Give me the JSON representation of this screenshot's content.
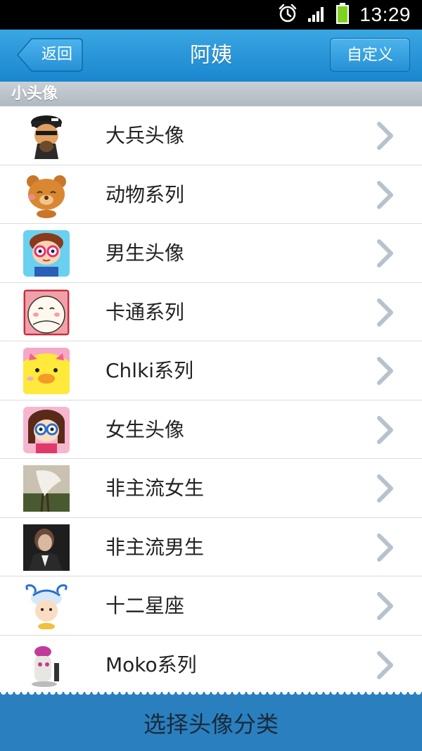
{
  "status_bar": {
    "time": "13:29",
    "icons": [
      "alarm-icon",
      "signal-icon",
      "battery-icon"
    ]
  },
  "nav": {
    "back_label": "返回",
    "title": "阿姨",
    "custom_label": "自定义"
  },
  "section": {
    "header": "小头像"
  },
  "list": {
    "items": [
      {
        "label": "大兵头像",
        "icon": "soldier-avatar"
      },
      {
        "label": "动物系列",
        "icon": "bear-avatar"
      },
      {
        "label": "男生头像",
        "icon": "boy-avatar"
      },
      {
        "label": "卡通系列",
        "icon": "cartoon-avatar"
      },
      {
        "label": "Chlki系列",
        "icon": "chick-avatar"
      },
      {
        "label": "女生头像",
        "icon": "girl-avatar"
      },
      {
        "label": "非主流女生",
        "icon": "photo-woman-avatar"
      },
      {
        "label": "非主流男生",
        "icon": "photo-man-avatar"
      },
      {
        "label": "十二星座",
        "icon": "zodiac-avatar"
      },
      {
        "label": "Moko系列",
        "icon": "moko-avatar"
      }
    ]
  },
  "bottom": {
    "label": "选择头像分类"
  },
  "colors": {
    "nav_blue": "#1f8cd3",
    "bottom_blue": "#2a7fbf",
    "section_gray": "#b9c1c8",
    "chevron_gray": "#b8c2cc"
  }
}
